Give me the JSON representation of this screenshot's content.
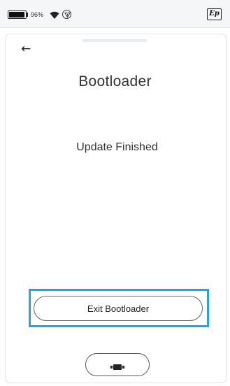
{
  "status_bar": {
    "battery_percent": "96%",
    "battery_level": 0.96,
    "wifi_icon": "wifi-icon",
    "signal_icon": "signal-circle-icon",
    "logo": "Ep"
  },
  "header": {
    "back_icon": "back-arrow-icon",
    "back_glyph": "←"
  },
  "main": {
    "title": "Bootloader",
    "status": "Update Finished"
  },
  "actions": {
    "exit_label": "Exit Bootloader",
    "highlight_color": "#2aa3db"
  },
  "bottom_nav": {
    "home_icon": "device-icon"
  }
}
